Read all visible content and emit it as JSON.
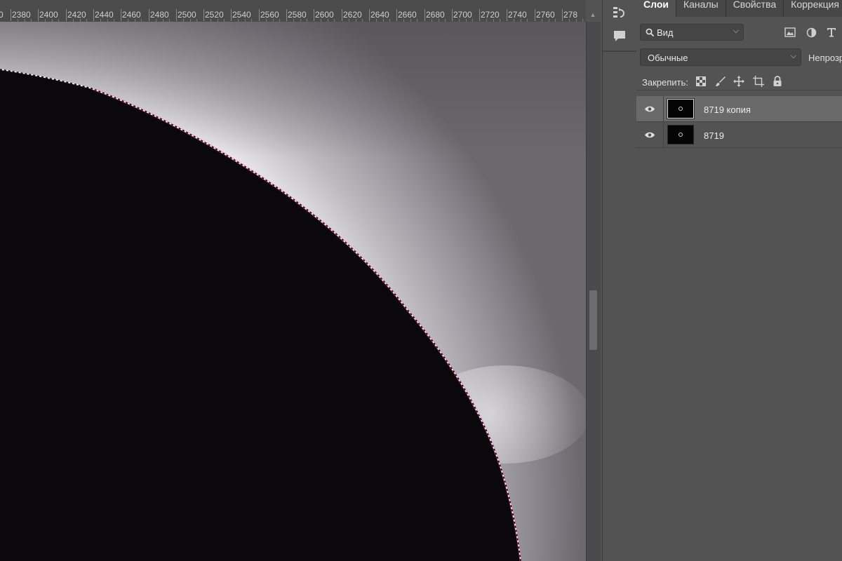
{
  "ruler": {
    "labels": [
      "2380",
      "2400",
      "2420",
      "2440",
      "2460",
      "2480",
      "2500",
      "2520",
      "2540",
      "2560",
      "2580",
      "2600",
      "2620",
      "2640",
      "2660",
      "2680",
      "2700",
      "2720",
      "2740",
      "2760",
      "278"
    ],
    "left_partial": "0"
  },
  "dock": {
    "history_icon": "history-icon",
    "comments_icon": "comments-icon"
  },
  "panel": {
    "tabs": [
      {
        "label": "Слои",
        "active": true
      },
      {
        "label": "Каналы",
        "active": false
      },
      {
        "label": "Свойства",
        "active": false
      },
      {
        "label": "Коррекция",
        "active": false
      }
    ],
    "filter": {
      "label": "Вид",
      "icons": [
        "image-filter-icon",
        "adjustment-filter-icon",
        "type-filter-icon"
      ]
    },
    "blend": {
      "mode": "Обычные",
      "opacity_label": "Непрозр"
    },
    "lock": {
      "label": "Закрепить:",
      "icons": [
        "lock-transparent-pixels-icon",
        "lock-image-pixels-icon",
        "lock-position-icon",
        "lock-artboard-icon",
        "lock-all-icon"
      ]
    },
    "layers": [
      {
        "name": "8719 копия",
        "visible": true,
        "selected": true
      },
      {
        "name": "8719",
        "visible": true,
        "selected": false
      }
    ]
  },
  "colors": {
    "panel_bg": "#535353",
    "selected_layer": "#6a6a6a",
    "moon_edge_pink": "#ff3fa0"
  }
}
